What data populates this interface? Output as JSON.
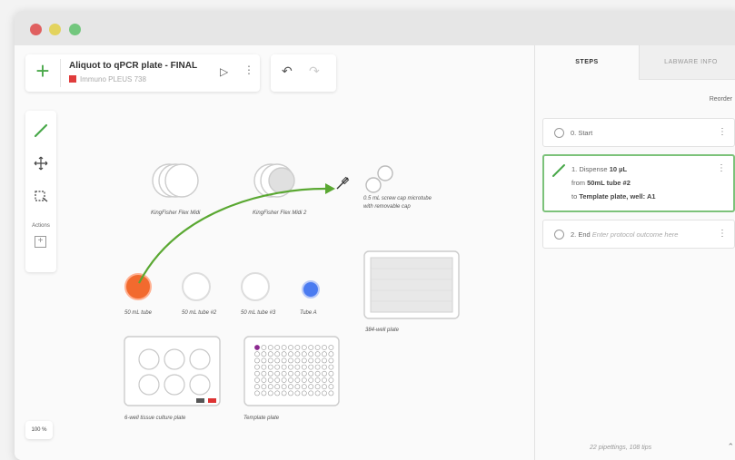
{
  "window": {
    "colors": {
      "close": "#e06060",
      "minimize": "#e3d35e",
      "maximize": "#73c77e"
    }
  },
  "protocol": {
    "add_icon": "plus-icon",
    "title": "Aliquot to qPCR plate - FINAL",
    "subtitle": "Immuno PLEUS 738",
    "play_icon": "▷",
    "more_icon": "⋮"
  },
  "history": {
    "undo_icon": "↶",
    "redo_icon": "↷"
  },
  "toolbar": {
    "actions_label": "Actions",
    "zoom_label": "100 %"
  },
  "labware": {
    "kingfisher1": "KingFisher Flex Midi",
    "kingfisher2": "KingFisher Flex Midi 2",
    "screwcap": "0.5 mL screw cap microtube",
    "screwcap2": "with removable cap",
    "tube50_1": "50 mL tube",
    "tube50_2": "50 mL tube #2",
    "tube50_3": "50 mL tube #3",
    "tubeA": "Tube A",
    "plate384": "384-well plate",
    "plate6": "6-well tissue culture plate",
    "template": "Template plate"
  },
  "panel": {
    "tabs": [
      "STEPS",
      "LABWARE INFO"
    ],
    "reorder": "Reorder",
    "steps": [
      {
        "label": "0. Start"
      },
      {
        "line1_prefix": "1. Dispense ",
        "line1_bold": "10 µL",
        "line2_prefix": "from ",
        "line2_bold": "50mL tube #2",
        "line3_prefix": "to ",
        "line3_bold": "Template plate, well: A1"
      },
      {
        "label": "2. End",
        "hint": "Enter protocol outcome here"
      }
    ],
    "summary": "22 pipettings, 108 tips",
    "accent": "#7cc27a"
  }
}
